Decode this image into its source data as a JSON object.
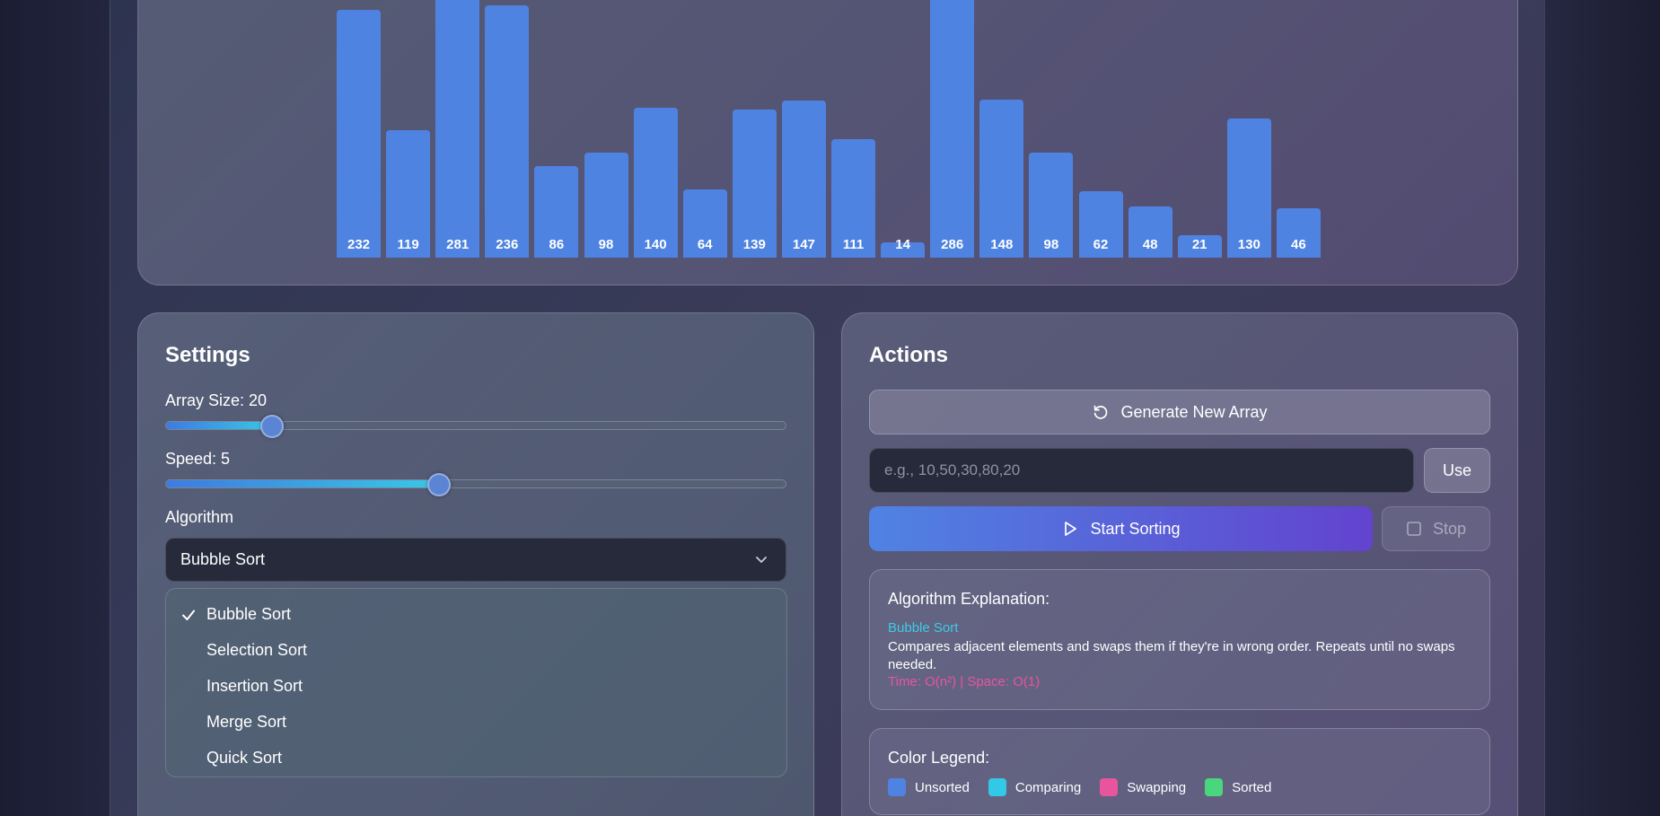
{
  "visualizer": {
    "bars": [
      {
        "value": 232,
        "label": "232"
      },
      {
        "value": 119,
        "label": "119"
      },
      {
        "value": 281,
        "label": "281"
      },
      {
        "value": 236,
        "label": "236"
      },
      {
        "value": 86,
        "label": "86"
      },
      {
        "value": 98,
        "label": "98"
      },
      {
        "value": 140,
        "label": "140"
      },
      {
        "value": 64,
        "label": "64"
      },
      {
        "value": 139,
        "label": "139"
      },
      {
        "value": 147,
        "label": "147"
      },
      {
        "value": 111,
        "label": "111"
      },
      {
        "value": 14,
        "label": "14"
      },
      {
        "value": 286,
        "label": "286"
      },
      {
        "value": 148,
        "label": "148"
      },
      {
        "value": 98,
        "label": "98"
      },
      {
        "value": 62,
        "label": "62"
      },
      {
        "value": 48,
        "label": "48"
      },
      {
        "value": 21,
        "label": "21"
      },
      {
        "value": 130,
        "label": "130"
      },
      {
        "value": 46,
        "label": "46"
      }
    ],
    "bar_color": "#4f83e2"
  },
  "settings": {
    "title": "Settings",
    "array_size_label": "Array Size: 20",
    "array_size_fraction": 0.17,
    "speed_label": "Speed: 5",
    "speed_fraction": 0.44,
    "algorithm_label": "Algorithm",
    "selected_algorithm": "Bubble Sort",
    "options": [
      "Bubble Sort",
      "Selection Sort",
      "Insertion Sort",
      "Merge Sort",
      "Quick Sort"
    ],
    "chevron_icon": "chevron-down-icon",
    "check_icon": "check-icon"
  },
  "actions": {
    "title": "Actions",
    "generate_label": "Generate New Array",
    "generate_icon": "refresh-icon",
    "input_placeholder": "e.g., 10,50,30,80,20",
    "use_label": "Use",
    "start_label": "Start Sorting",
    "start_icon": "play-icon",
    "stop_label": "Stop",
    "stop_icon": "stop-icon"
  },
  "explanation": {
    "title": "Algorithm Explanation:",
    "name": "Bubble Sort",
    "description": "Compares adjacent elements and swaps them if they're in wrong order. Repeats until no swaps needed.",
    "complexity": "Time: O(n²) | Space: O(1)"
  },
  "legend": {
    "title": "Color Legend:",
    "items": [
      {
        "label": "Unsorted",
        "color": "#4f83e2"
      },
      {
        "label": "Comparing",
        "color": "#33c9e6"
      },
      {
        "label": "Swapping",
        "color": "#e8559c"
      },
      {
        "label": "Sorted",
        "color": "#4ad67c"
      }
    ]
  }
}
